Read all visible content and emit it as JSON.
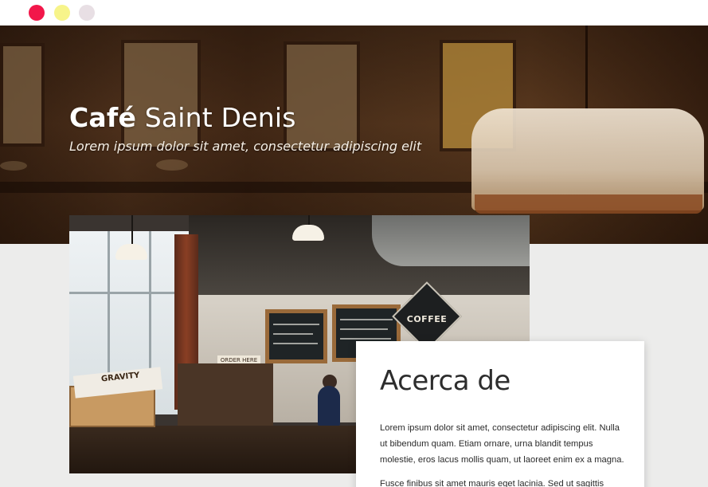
{
  "window": {
    "controls": [
      "close-dot",
      "minimize-dot",
      "maximize-dot"
    ],
    "colors": {
      "close": "#f2174a",
      "minimize": "#f7f48a",
      "maximize": "#e8dfe4"
    }
  },
  "hero": {
    "title_bold": "Café",
    "title_rest": "Saint Denis",
    "subtitle": "Lorem ipsum dolor sit amet, consectetur adipiscing elit"
  },
  "photo": {
    "coffee_sign": "COFFEE",
    "order_sign": "ORDER HERE",
    "crate_label": "GRAVITY"
  },
  "about": {
    "heading": "Acerca de",
    "paragraph_1": "Lorem ipsum dolor sit amet, consectetur adipiscing elit. Nulla ut bibendum quam. Etiam ornare, urna blandit tempus molestie, eros lacus mollis quam, ut laoreet enim ex a magna.",
    "paragraph_2": "Fusce finibus sit amet mauris eget lacinia. Sed ut sagittis"
  }
}
